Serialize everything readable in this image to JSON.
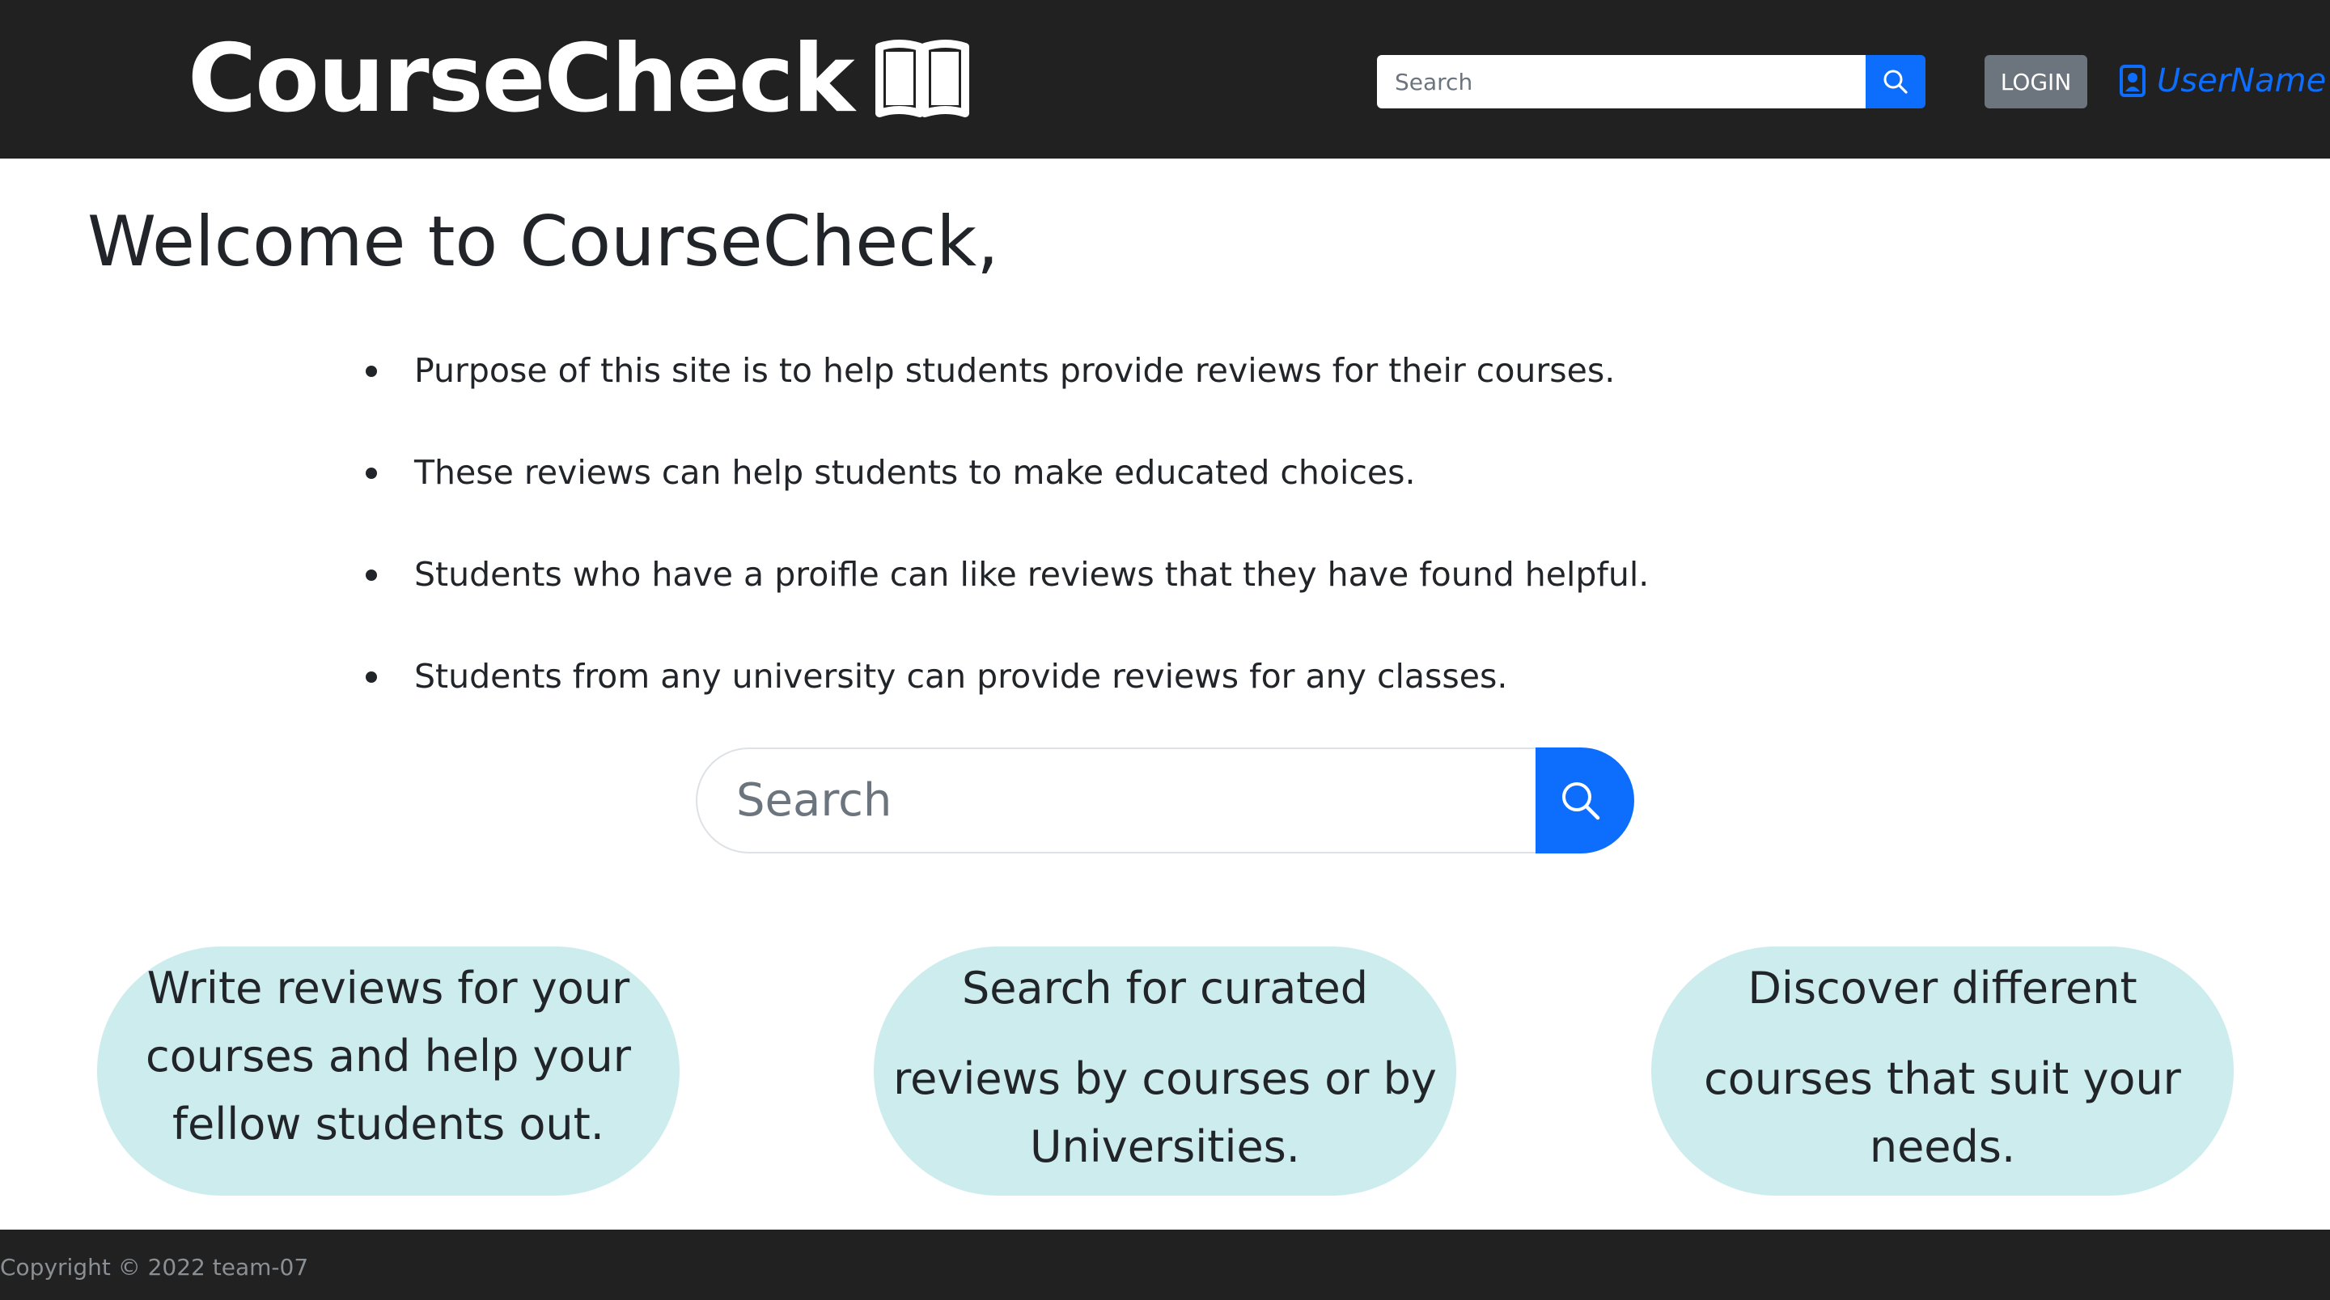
{
  "header": {
    "brand": "CourseCheck",
    "brand_icon": "book-icon",
    "search_placeholder": "Search",
    "search_icon": "search-icon",
    "login_label": "LOGIN",
    "user_icon": "person-badge-icon",
    "username": "UserName"
  },
  "main": {
    "welcome": "Welcome to CourseCheck,",
    "bullets": [
      "Purpose of this site is to help students provide reviews for their courses.",
      "These reviews can help students to make educated choices.",
      "Students who have a proifle can like reviews that they have found helpful.",
      "Students from any university can provide reviews for any classes."
    ],
    "search_placeholder": "Search"
  },
  "features": [
    {
      "lines": [
        "Write reviews for your",
        "courses and help your",
        "fellow students out."
      ]
    },
    {
      "lines": [
        "Search for curated",
        "reviews by courses or by",
        "Universities."
      ]
    },
    {
      "lines": [
        "Discover different",
        "courses that suit your",
        "needs."
      ]
    }
  ],
  "footer": {
    "copyright": "Copyright © 2022 team-07"
  },
  "colors": {
    "navbar": "#212121",
    "primary": "#0d6efd",
    "secondary": "#6c757d",
    "pill": "#cdeced"
  }
}
